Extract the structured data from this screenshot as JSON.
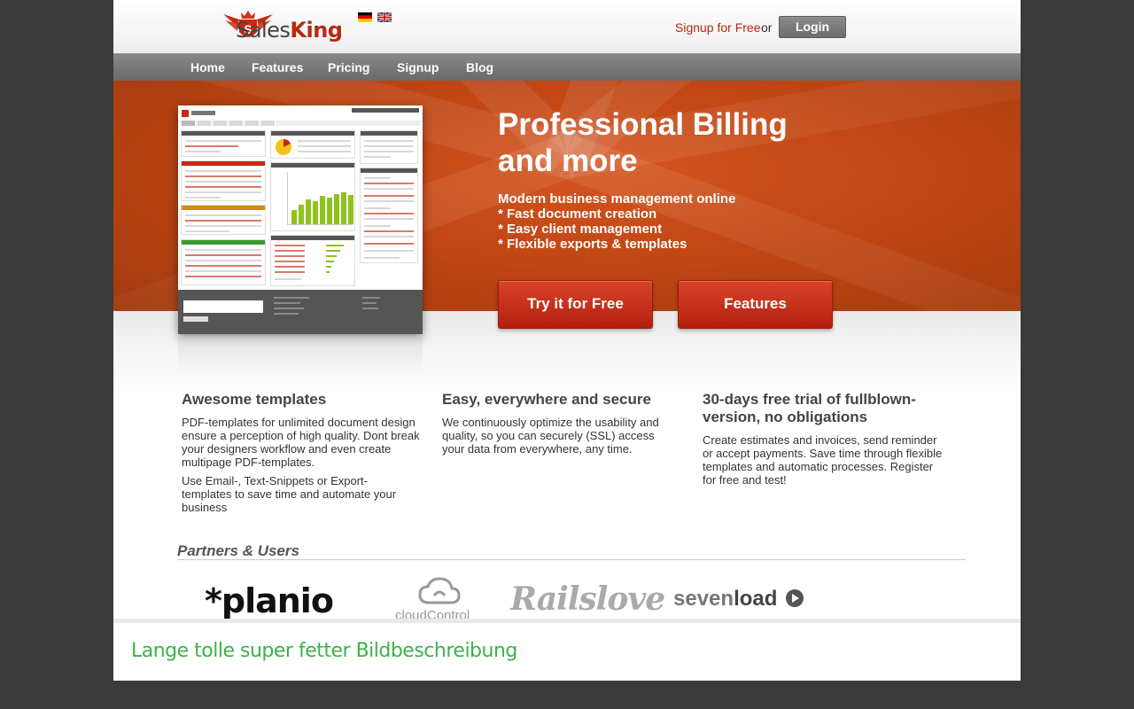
{
  "header": {
    "logo_text_prefix": "Sales",
    "logo_text_suffix": "King",
    "signup_link": "Signup for Free",
    "or_text": "or",
    "login_button": "Login",
    "flags": [
      "german-flag-icon",
      "british-flag-icon"
    ]
  },
  "nav": {
    "items": [
      {
        "label": "Home"
      },
      {
        "label": "Features"
      },
      {
        "label": "Pricing"
      },
      {
        "label": "Signup"
      },
      {
        "label": "Blog"
      }
    ]
  },
  "hero": {
    "title": "Professional Billing\nand more",
    "subtitle_lines": [
      "Modern business management online",
      "* Fast document creation",
      "* Easy client management",
      "* Flexible exports & templates"
    ],
    "cta_try": "Try it for Free",
    "cta_features": "Features"
  },
  "features": [
    {
      "title": "Awesome templates",
      "paragraphs": [
        "PDF-templates for unlimited document design ensure a perception of high quality. Dont break your designers workflow and even create multipage PDF-templates.",
        "Use Email-, Text-Snippets or Export-templates to save time and automate your business"
      ]
    },
    {
      "title": "Easy, everywhere and secure",
      "paragraphs": [
        "We continuously optimize the usability and quality, so you can securely (SSL) access your data from everywhere, any time."
      ]
    },
    {
      "title": "30-days free trial of fullblown-version, no obligations",
      "paragraphs": [
        "Create estimates and invoices, send reminder or accept payments. Save time through flexible templates and automatic processes. Register for free and test!"
      ]
    }
  ],
  "partners": {
    "title": "Partners & Users",
    "logos": {
      "planio": "*planio",
      "cloudcontrol": "cloudControl",
      "railslove": "Railslove",
      "sevenload_prefix": "seven",
      "sevenload_suffix": "load"
    }
  },
  "caption": "Lange tolle super fetter Bildbeschreibung",
  "colors": {
    "brand_red": "#b62a10",
    "hero_orange": "#c04614",
    "caption_green": "#3bb34a"
  }
}
